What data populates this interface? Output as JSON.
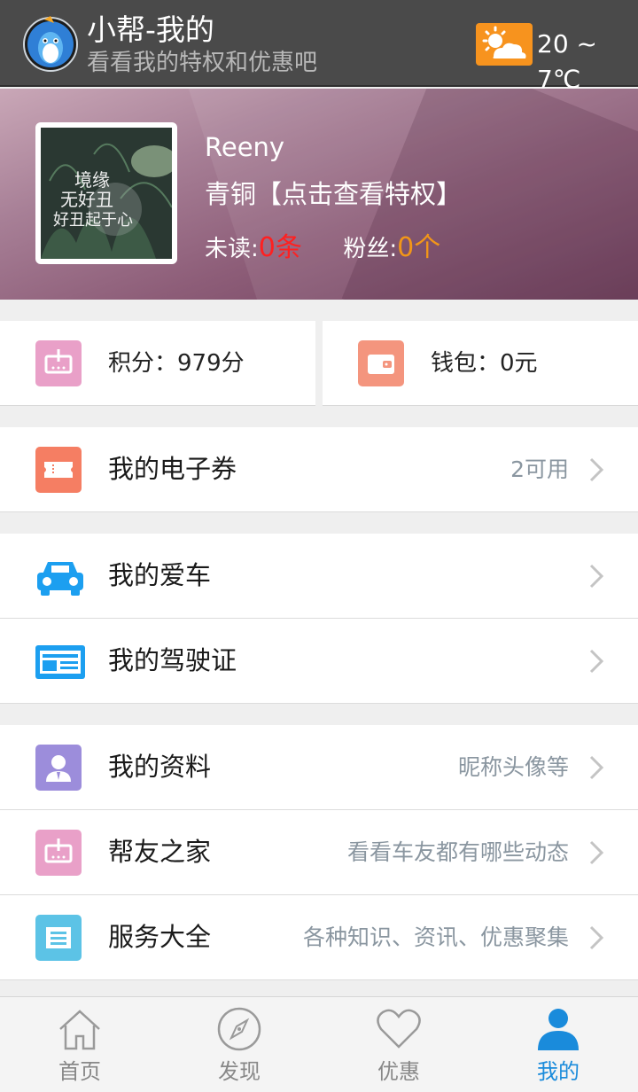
{
  "header": {
    "title": "小帮-我的",
    "subtitle": "看看我的特权和优惠吧",
    "weather_icon": "sun-cloud-icon",
    "temperature": "20 ~ 7℃",
    "accent_color": "#f7931e"
  },
  "profile": {
    "avatar_text": [
      "境缘",
      "无好丑",
      "好丑起于心"
    ],
    "name": "Reeny",
    "level_text": "青铜【点击查看特权】",
    "unread_label": "未读:",
    "unread_value": "0条",
    "fans_label": "粉丝:",
    "fans_value": "0个"
  },
  "summary": {
    "points": {
      "label": "积分：979分",
      "icon": "points-icon",
      "color": "#e9a0c8"
    },
    "wallet": {
      "label": "钱包：0元",
      "icon": "wallet-icon",
      "color": "#f4957e"
    }
  },
  "rows": [
    {
      "label": "我的电子券",
      "hint": "2可用",
      "icon": "coupon-icon",
      "color": "#f57e63"
    },
    {
      "label": "我的爱车",
      "hint": "",
      "icon": "car-icon",
      "color": "#1c9ff0"
    },
    {
      "label": "我的驾驶证",
      "hint": "",
      "icon": "license-icon",
      "color": "#1c9ff0"
    },
    {
      "label": "我的资料",
      "hint": "昵称头像等",
      "icon": "profile-icon",
      "color": "#9c8ddb"
    },
    {
      "label": "帮友之家",
      "hint": "看看车友都有哪些动态",
      "icon": "community-icon",
      "color": "#e9a0c8"
    },
    {
      "label": "服务大全",
      "hint": "各种知识、资讯、优惠聚集",
      "icon": "services-icon",
      "color": "#5cc3e6"
    }
  ],
  "nav": [
    {
      "label": "首页",
      "icon": "home-icon",
      "active": false
    },
    {
      "label": "发现",
      "icon": "compass-icon",
      "active": false
    },
    {
      "label": "优惠",
      "icon": "heart-icon",
      "active": false
    },
    {
      "label": "我的",
      "icon": "user-icon",
      "active": true
    }
  ],
  "colors": {
    "active_nav": "#1a8bdb",
    "unread_red": "#ff2020",
    "fans_orange": "#f29618"
  }
}
